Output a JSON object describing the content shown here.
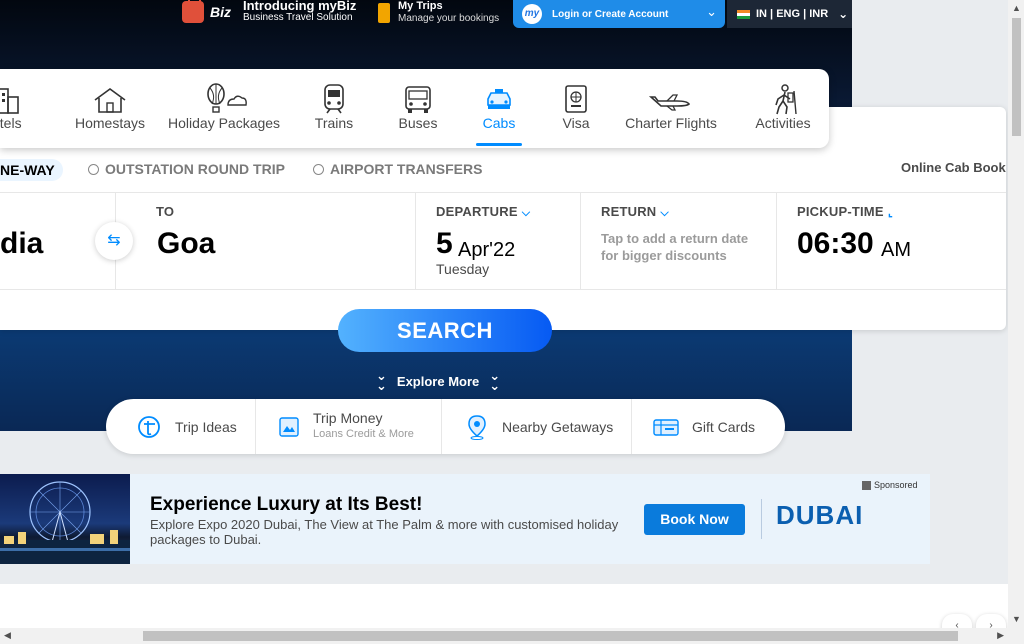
{
  "header": {
    "mybiz_badge": "Biz",
    "mybiz_title": "Introducing myBiz",
    "mybiz_sub": "Business Travel Solution",
    "mytrips_title": "My Trips",
    "mytrips_sub": "Manage your bookings",
    "login_label": "Login or Create Account",
    "avatar_text": "my",
    "locale": "IN | ENG | INR"
  },
  "nav": [
    {
      "label": "otels",
      "icon": "hotel-icon"
    },
    {
      "label": "Homestays",
      "icon": "homestay-icon"
    },
    {
      "label": "Holiday Packages",
      "icon": "holiday-balloon-icon"
    },
    {
      "label": "Trains",
      "icon": "train-icon"
    },
    {
      "label": "Buses",
      "icon": "bus-icon"
    },
    {
      "label": "Cabs",
      "icon": "cab-icon",
      "active": true
    },
    {
      "label": "Visa",
      "icon": "passport-icon"
    },
    {
      "label": "Charter Flights",
      "icon": "charter-plane-icon"
    },
    {
      "label": "Activities",
      "icon": "activities-icon"
    }
  ],
  "trip_types": {
    "oneway": "NE-WAY",
    "outstation": "OUTSTATION ROUND TRIP",
    "airport": "AIRPORT TRANSFERS"
  },
  "online_cab": "Online Cab Book",
  "from": {
    "value": "dia"
  },
  "to": {
    "label": "TO",
    "value": "Goa"
  },
  "departure": {
    "label": "DEPARTURE",
    "day": "5",
    "month_year": "Apr'22",
    "weekday": "Tuesday"
  },
  "return": {
    "label": "RETURN",
    "hint": "Tap to add a return date for bigger discounts"
  },
  "pickup": {
    "label": "PICKUP-TIME",
    "time": "06:30",
    "ampm": "AM"
  },
  "search_label": "SEARCH",
  "explore_label": "Explore More",
  "quick_links": [
    {
      "label": "Trip Ideas",
      "icon": "trip-ideas-icon"
    },
    {
      "label": "Trip Money",
      "sub": "Loans Credit & More",
      "icon": "trip-money-icon"
    },
    {
      "label": "Nearby Getaways",
      "icon": "location-pin-icon"
    },
    {
      "label": "Gift Cards",
      "icon": "gift-card-icon"
    }
  ],
  "ad": {
    "title": "Experience Luxury at Its Best!",
    "desc": "Explore Expo 2020 Dubai, The View at The Palm & more with customised holiday packages to Dubai.",
    "cta": "Book Now",
    "logo": "DUBAI",
    "sponsored": "Sponsored"
  },
  "colors": {
    "accent": "#008cff",
    "search_start": "#53b2fe",
    "search_end": "#065af3",
    "login_bg": "#1f8ce8"
  }
}
